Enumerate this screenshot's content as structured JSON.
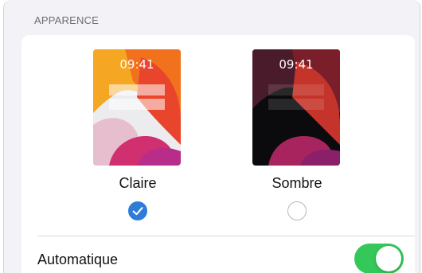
{
  "section": {
    "header": "APPARENCE"
  },
  "appearance": {
    "light": {
      "label": "Claire",
      "time": "09:41",
      "selected": true
    },
    "dark": {
      "label": "Sombre",
      "time": "09:41",
      "selected": false
    }
  },
  "automatic": {
    "label": "Automatique",
    "enabled": true
  },
  "colors": {
    "accent": "#2f7bd8",
    "toggle_on": "#34c759",
    "background": "#f2f2f7"
  },
  "icons": {
    "checked": "checkmark-icon"
  }
}
